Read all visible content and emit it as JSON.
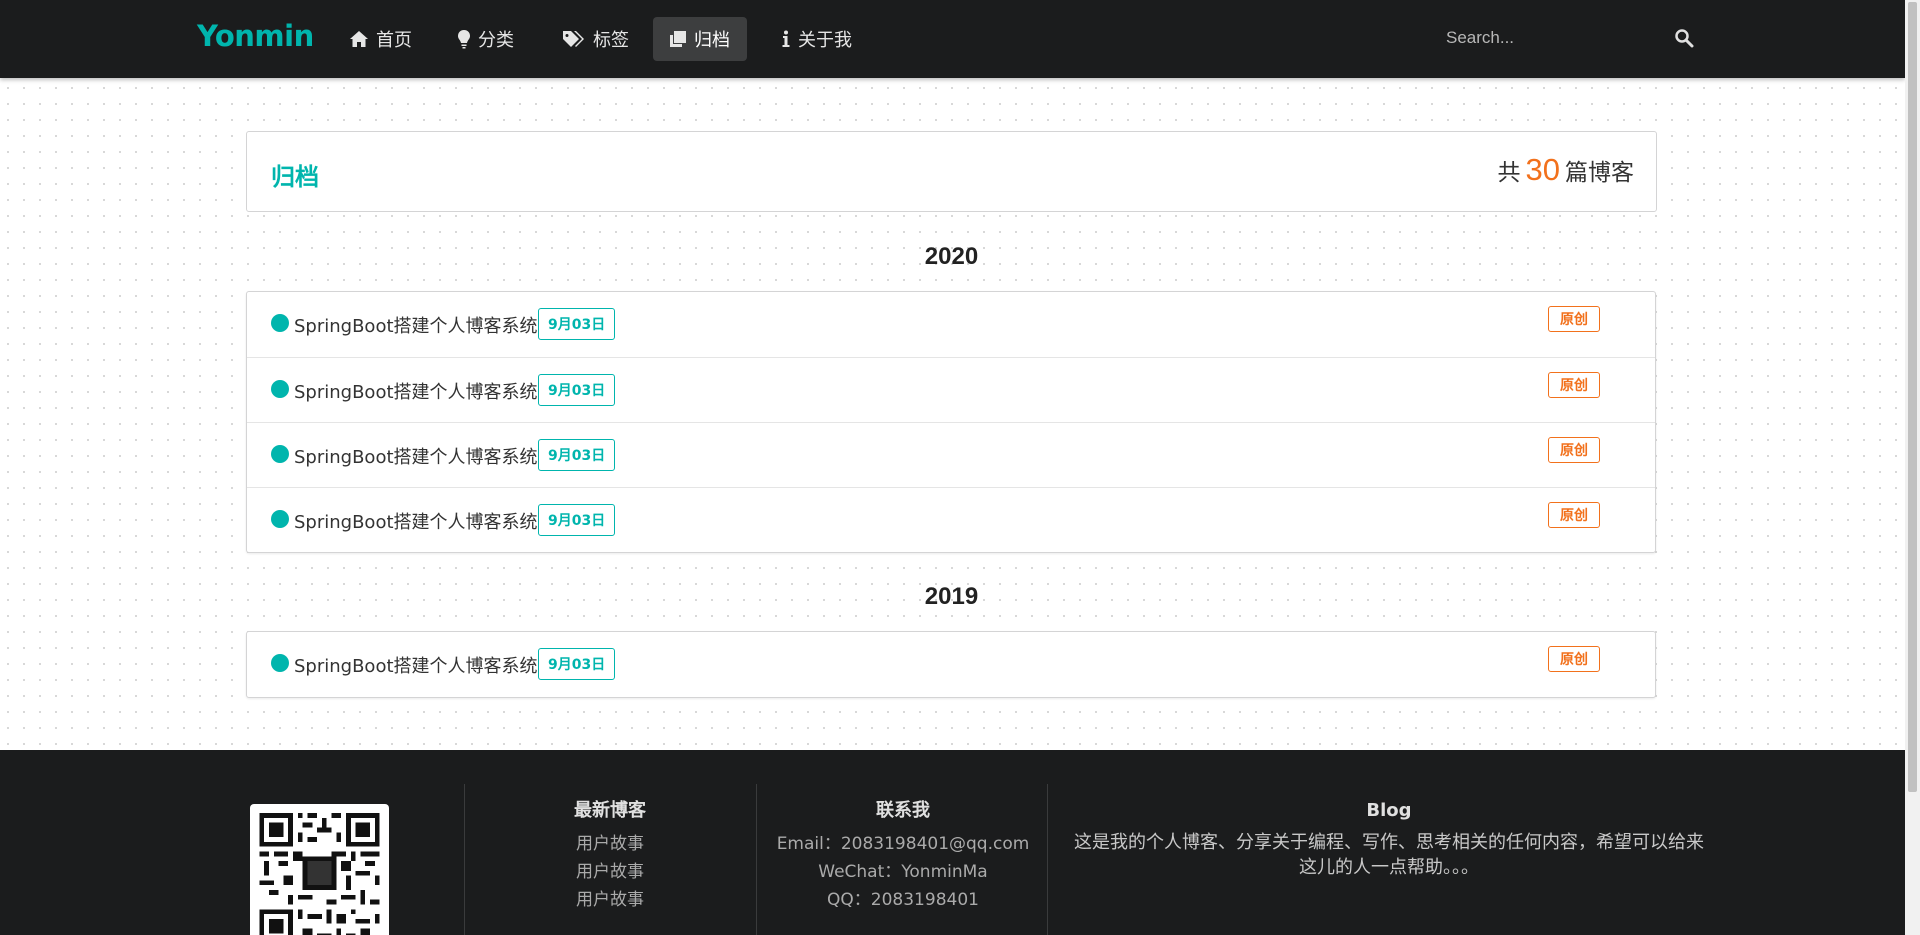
{
  "nav": {
    "brand": "Yonmin",
    "items": [
      {
        "label": "首页",
        "icon": "home-icon",
        "active": false
      },
      {
        "label": "分类",
        "icon": "lightbulb-icon",
        "active": false
      },
      {
        "label": "标签",
        "icon": "tags-icon",
        "active": false
      },
      {
        "label": "归档",
        "icon": "clone-icon",
        "active": true
      },
      {
        "label": "关于我",
        "icon": "info-icon",
        "active": false
      }
    ],
    "search_placeholder": "Search..."
  },
  "header": {
    "title": "归档",
    "count_prefix": "共",
    "count": "30",
    "count_suffix": "篇博客"
  },
  "archives": [
    {
      "year": "2020",
      "posts": [
        {
          "title": "SpringBoot搭建个人博客系统",
          "date": "9月03日",
          "flag": "原创"
        },
        {
          "title": "SpringBoot搭建个人博客系统",
          "date": "9月03日",
          "flag": "原创"
        },
        {
          "title": "SpringBoot搭建个人博客系统",
          "date": "9月03日",
          "flag": "原创"
        },
        {
          "title": "SpringBoot搭建个人博客系统",
          "date": "9月03日",
          "flag": "原创"
        }
      ]
    },
    {
      "year": "2019",
      "posts": [
        {
          "title": "SpringBoot搭建个人博客系统",
          "date": "9月03日",
          "flag": "原创"
        }
      ]
    }
  ],
  "footer": {
    "latest": {
      "title": "最新博客",
      "items": [
        "用户故事",
        "用户故事",
        "用户故事"
      ]
    },
    "contact": {
      "title": "联系我",
      "email": "Email：2083198401@qq.com",
      "wechat": "WeChat：YonminMa",
      "qq": "QQ：2083198401"
    },
    "blog": {
      "title": "Blog",
      "text": "这是我的个人博客、分享关于编程、写作、思考相关的任何内容，希望可以给来这儿的人一点帮助。。。"
    }
  },
  "colors": {
    "accent": "#00b5ad",
    "orange": "#f2711c",
    "dark": "#1b1c1d"
  }
}
